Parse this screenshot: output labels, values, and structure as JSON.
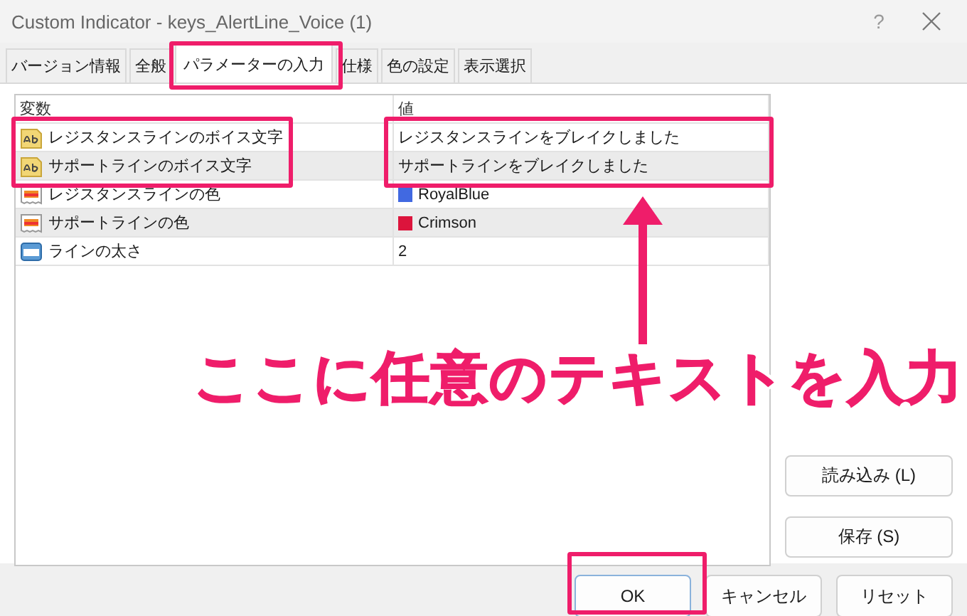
{
  "window": {
    "title": "Custom Indicator - keys_AlertLine_Voice (1)",
    "help": "?"
  },
  "tabs": [
    {
      "label": "バージョン情報",
      "selected": false
    },
    {
      "label": "全般",
      "selected": false
    },
    {
      "label": "パラメーターの入力",
      "selected": true
    },
    {
      "label": "仕様",
      "selected": false
    },
    {
      "label": "色の設定",
      "selected": false
    },
    {
      "label": "表示選択",
      "selected": false
    }
  ],
  "table": {
    "columns": [
      "変数",
      "値"
    ],
    "rows": [
      {
        "kind": "text",
        "name": "レジスタンスラインのボイス文字",
        "value": "レジスタンスラインをブレイクしました"
      },
      {
        "kind": "text",
        "name": "サポートラインのボイス文字",
        "value": "サポートラインをブレイクしました"
      },
      {
        "kind": "color",
        "name": "レジスタンスラインの色",
        "value": "RoyalBlue",
        "color": "#4169e1"
      },
      {
        "kind": "color",
        "name": "サポートラインの色",
        "value": "Crimson",
        "color": "#dc143c"
      },
      {
        "kind": "number",
        "name": "ラインの太さ",
        "value": "2"
      }
    ]
  },
  "side_buttons": [
    "読み込み (L)",
    "保存 (S)"
  ],
  "buttons": [
    {
      "label": "OK",
      "default": true
    },
    {
      "label": "キャンセル",
      "default": false
    },
    {
      "label": "リセット",
      "default": false
    }
  ],
  "annotation": {
    "callout": "ここに任意のテキストを入力"
  }
}
